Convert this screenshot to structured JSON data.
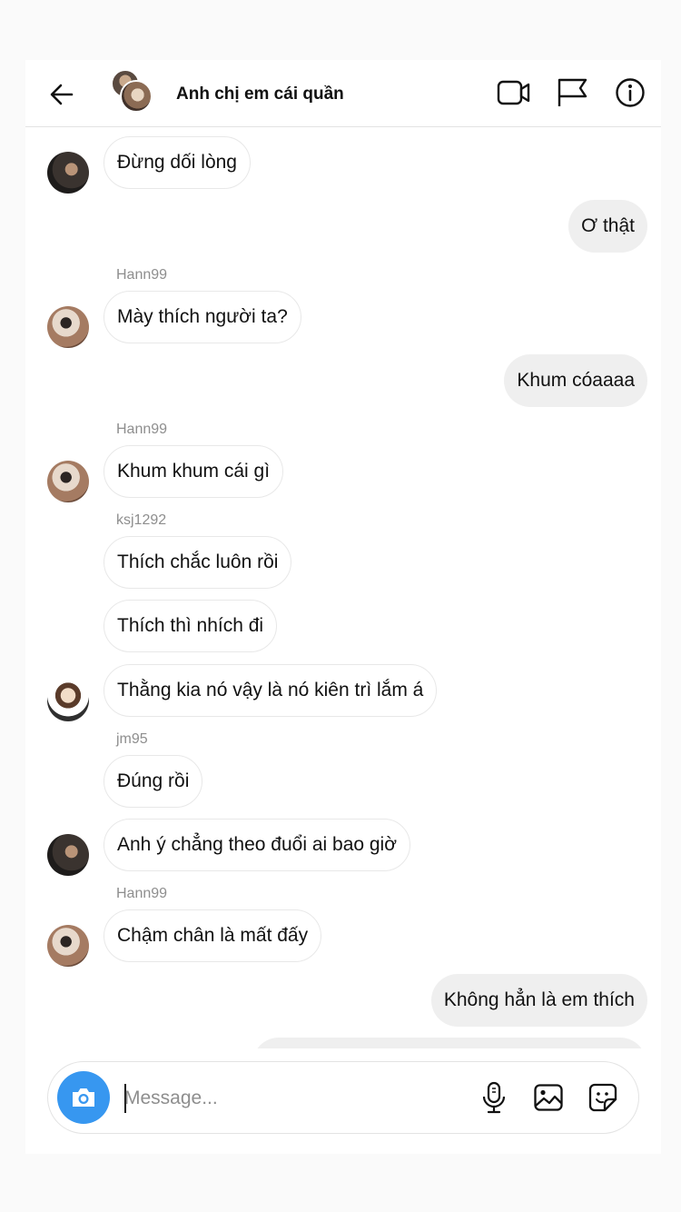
{
  "header": {
    "title": "Anh chị em cái quần"
  },
  "messages": [
    {
      "text": "Đừng dối lòng"
    },
    {
      "text": "Ơ thật"
    },
    {
      "sender": "Hann99",
      "text": "Mày thích người ta?"
    },
    {
      "text": "Khum cóaaaa"
    },
    {
      "sender": "Hann99",
      "text": "Khum khum cái gì"
    },
    {
      "sender": "ksj1292",
      "text": "Thích chắc luôn rồi"
    },
    {
      "text": "Thích thì nhích đi"
    },
    {
      "text": "Thằng kia nó vậy là nó kiên trì lắm á"
    },
    {
      "sender": "jm95",
      "text": "Đúng rồi"
    },
    {
      "text": "Anh ý chẳng theo đuổi ai bao giờ"
    },
    {
      "sender": "Hann99",
      "text": "Chậm chân là mất đấy"
    },
    {
      "text": "Không hẳn là em thích"
    }
  ],
  "composer": {
    "placeholder": "Message..."
  },
  "colors": {
    "accent": "#3797f0",
    "outgoing_bubble": "#efefef",
    "incoming_border": "#e8e8e8",
    "sender_name": "#8e8e8e"
  },
  "icons": [
    "back-arrow-icon",
    "video-call-icon",
    "flag-icon",
    "info-icon",
    "camera-icon",
    "microphone-icon",
    "gallery-icon",
    "sticker-icon"
  ]
}
